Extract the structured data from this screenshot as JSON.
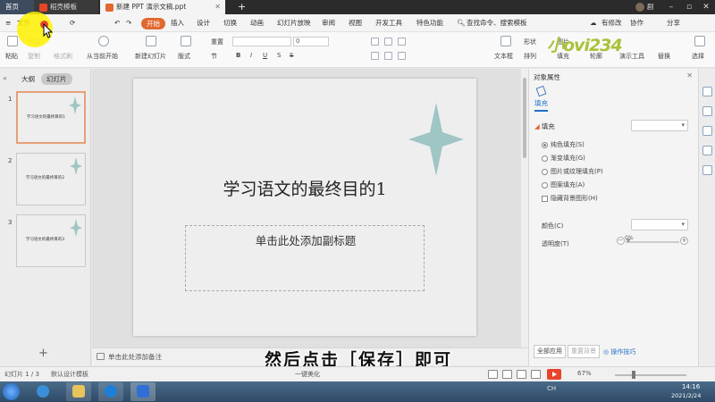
{
  "titlebar": {
    "home_tab": "首页",
    "templates_tab": "稻壳模板",
    "doc_tab": "新建 PPT 演示文稿.ppt",
    "add_tab": "+",
    "user_name": "剧"
  },
  "menu": {
    "file": "文件",
    "start": "开始",
    "insert": "插入",
    "design": "设计",
    "transition": "切换",
    "animation": "动画",
    "slideshow": "幻灯片放映",
    "review": "审阅",
    "view": "视图",
    "developer": "开发工具",
    "special": "特色功能",
    "search": "查找命令、搜索模板",
    "has_changes": "有修改",
    "collaborate": "协作",
    "share": "分享"
  },
  "ribbon": {
    "paste": "粘贴",
    "cut": "剪切",
    "copy": "复制",
    "format_painter": "格式刷",
    "from_current": "从当前开始",
    "new_slide": "新建幻灯片",
    "layout": "版式",
    "reset": "重置",
    "section": "节",
    "font_size_value": "0",
    "textbox": "文本框",
    "shape": "形状",
    "arrange": "排列",
    "outline": "轮廓",
    "picture": "图片",
    "fill": "填充",
    "slideshow_tools": "演示工具",
    "replace": "替换",
    "select": "选择"
  },
  "watermark": "小ovi234",
  "slide_panel": {
    "outline_tab": "大纲",
    "slides_tab": "幻灯片",
    "thumbs": [
      {
        "num": "1",
        "title": "学习语文的最终目的1"
      },
      {
        "num": "2",
        "title": "学习语文的最终目的2"
      },
      {
        "num": "3",
        "title": "学习语文的最终目的3"
      }
    ],
    "add": "+"
  },
  "slide": {
    "title": "学习语文的最终目的1",
    "subtitle_placeholder": "单击此处添加副标题",
    "star_color": "#9fc5c5"
  },
  "notes": {
    "placeholder": "单击此处添加备注"
  },
  "caption": "然后点击［保存］即可",
  "properties": {
    "title": "对象属性",
    "fill_tab": "填充",
    "section": "填充",
    "options": [
      {
        "label": "纯色填充(S)",
        "selected": true
      },
      {
        "label": "渐变填充(G)",
        "selected": false
      },
      {
        "label": "图片或纹理填充(P)",
        "selected": false
      },
      {
        "label": "图案填充(A)",
        "selected": false
      }
    ],
    "hide_bg": "隐藏背景图形(H)",
    "color_label": "颜色(C)",
    "transparency_label": "透明度(T)",
    "transparency_value": "0%",
    "apply_all": "全部应用",
    "reset_bg": "重置背景",
    "tips": "操作技巧"
  },
  "statusbar": {
    "slide_count": "幻灯片 1 / 3",
    "template": "默认设计模板",
    "beautify": "一键美化",
    "zoom": "67%"
  },
  "taskbar": {
    "tray": "CH",
    "time": "14:16",
    "date": "2021/2/24"
  },
  "colors": {
    "accent": "#e1682f",
    "highlight": "#fff100",
    "link": "#1e6ec8"
  }
}
